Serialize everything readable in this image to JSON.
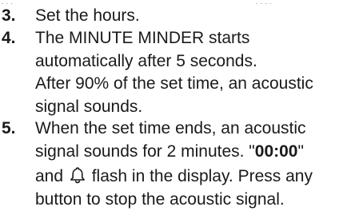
{
  "header_fragment": {
    "left": "...",
    "right": "...."
  },
  "steps": [
    {
      "number": "3.",
      "lines": [
        "Set the hours."
      ]
    },
    {
      "number": "4.",
      "lines": [
        "The MINUTE MINDER starts",
        "automatically after 5 seconds.",
        "After 90% of the set time, an acoustic",
        "signal sounds."
      ]
    },
    {
      "number": "5.",
      "line1": "When the set time ends, an acoustic",
      "line2_pre": "signal sounds for 2 minutes. \"",
      "line2_bold": "00:00",
      "line2_post": "\"",
      "line3_pre": "and ",
      "line3_post": " flash in the display. Press any",
      "line4": "button to stop the acoustic signal."
    }
  ],
  "icons": {
    "bell": "bell-icon"
  }
}
